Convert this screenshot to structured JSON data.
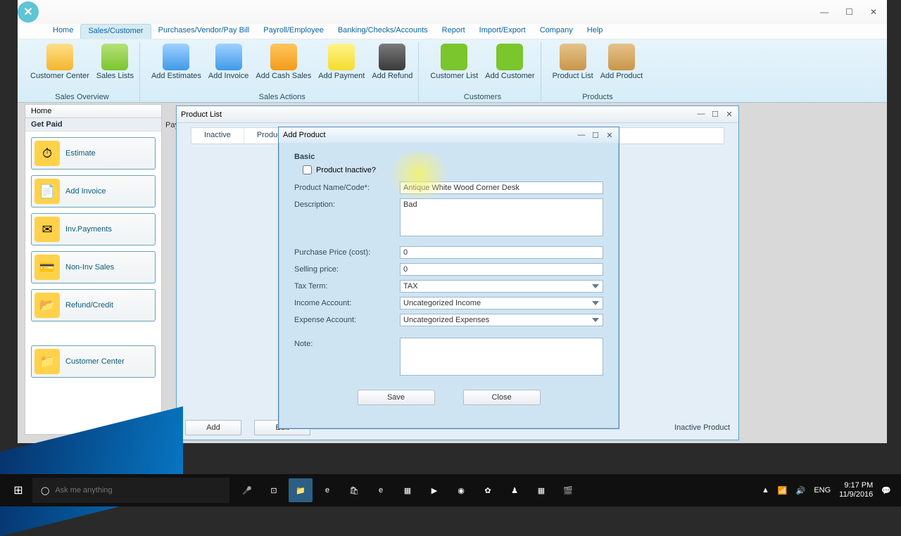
{
  "window_controls": {
    "min": "—",
    "max": "☐",
    "close": "✕"
  },
  "menus": {
    "items": [
      {
        "label": "Home"
      },
      {
        "label": "Sales/Customer",
        "active": true
      },
      {
        "label": "Purchases/Vendor/Pay Bill"
      },
      {
        "label": "Payroll/Employee"
      },
      {
        "label": "Banking/Checks/Accounts"
      },
      {
        "label": "Report"
      },
      {
        "label": "Import/Export"
      },
      {
        "label": "Company"
      },
      {
        "label": "Help"
      }
    ]
  },
  "ribbon": {
    "groups": [
      {
        "label": "Sales Overview",
        "btns": [
          {
            "label": "Customer Center",
            "icon": "folder"
          },
          {
            "label": "Sales Lists",
            "icon": "green"
          }
        ]
      },
      {
        "label": "Sales Actions",
        "btns": [
          {
            "label": "Add Estimates",
            "icon": "blue"
          },
          {
            "label": "Add Invoice",
            "icon": "blue"
          },
          {
            "label": "Add Cash Sales",
            "icon": "orange"
          },
          {
            "label": "Add Payment",
            "icon": "yellow"
          },
          {
            "label": "Add Refund",
            "icon": "dark"
          }
        ]
      },
      {
        "label": "Customers",
        "btns": [
          {
            "label": "Customer List",
            "icon": "greeno"
          },
          {
            "label": "Add Customer",
            "icon": "greeno"
          }
        ]
      },
      {
        "label": "Products",
        "btns": [
          {
            "label": "Product List",
            "icon": "box"
          },
          {
            "label": "Add Product",
            "icon": "box"
          }
        ]
      }
    ]
  },
  "home_tab": {
    "title": "Home",
    "section": "Get Paid",
    "section2": "Pay O",
    "buttons": [
      {
        "label": "Estimate",
        "icon": "⏱"
      },
      {
        "label": "Add Invoice",
        "icon": "📄"
      },
      {
        "label": "Inv.Payments",
        "icon": "✉"
      },
      {
        "label": "Non-Inv Sales",
        "icon": "💳"
      },
      {
        "label": "Refund/Credit",
        "icon": "📂"
      }
    ],
    "cc": {
      "label": "Customer Center",
      "icon": "📁"
    }
  },
  "product_list": {
    "title": "Product List",
    "columns": [
      "Inactive",
      "Product Name"
    ],
    "footer": {
      "add": "Add",
      "edit": "Edit",
      "inactive": "Inactive Product"
    }
  },
  "dialog": {
    "title": "Add Product",
    "sections": {
      "basic": "Basic"
    },
    "fields": {
      "inactive_label": "Product Inactive?",
      "name_label": "Product Name/Code*:",
      "name_value": "Antique White Wood Corner Desk",
      "desc_label": "Description:",
      "desc_value": "Bad",
      "purchase_label": "Purchase Price (cost):",
      "purchase_value": "0",
      "selling_label": "Selling price:",
      "selling_value": "0",
      "tax_label": "Tax Term:",
      "tax_value": "TAX",
      "income_label": "Income Account:",
      "income_value": "Uncategorized Income",
      "expense_label": "Expense Account:",
      "expense_value": "Uncategorized Expenses",
      "note_label": "Note:",
      "note_value": ""
    },
    "buttons": {
      "save": "Save",
      "close": "Close"
    }
  },
  "taskbar": {
    "search_placeholder": "Ask me anything",
    "tray": {
      "net": "▲",
      "vol": "🔊",
      "lang": "ENG",
      "time": "9:17 PM",
      "date": "11/9/2016"
    }
  }
}
